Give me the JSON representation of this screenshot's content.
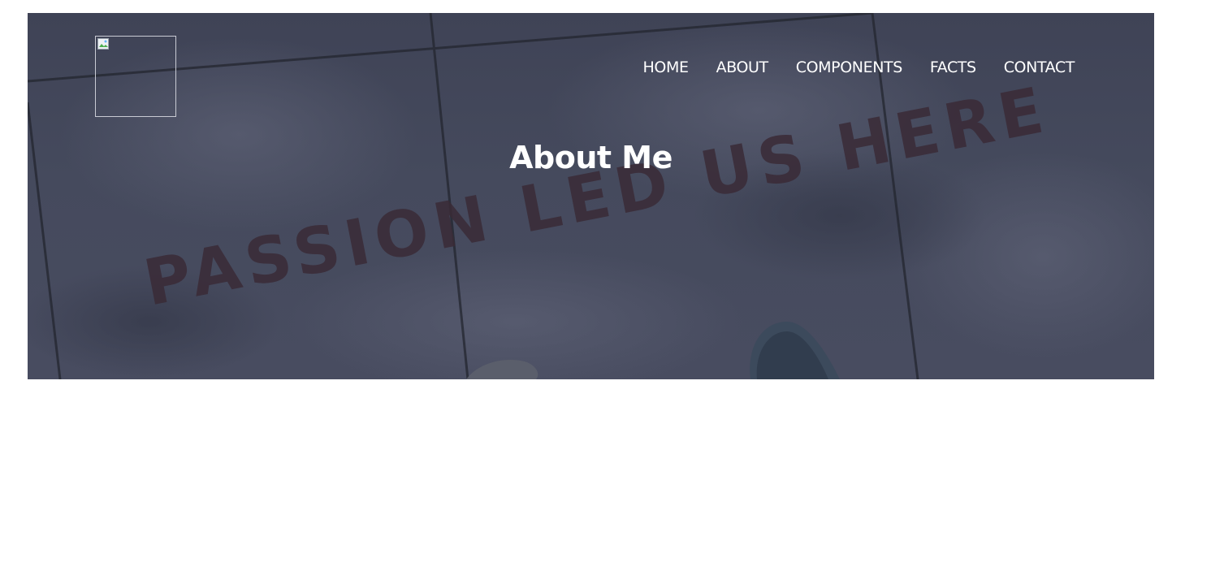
{
  "nav": {
    "items": [
      {
        "label": "HOME"
      },
      {
        "label": "ABOUT"
      },
      {
        "label": "COMPONENTS"
      },
      {
        "label": "FACTS"
      },
      {
        "label": "CONTACT"
      }
    ]
  },
  "hero": {
    "title": "About Me",
    "background_text": "PASSION LED US HERE",
    "overlay_color": "#434759"
  }
}
